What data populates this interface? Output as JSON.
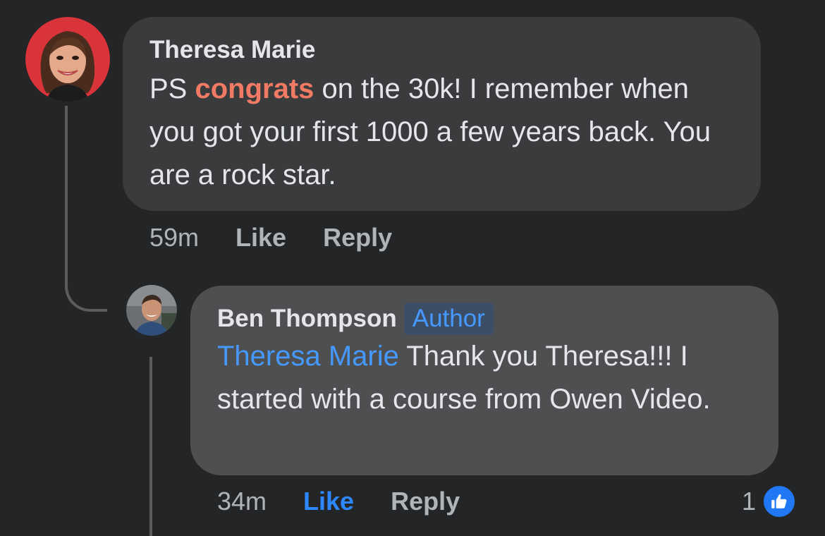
{
  "comments": [
    {
      "author": "Theresa Marie",
      "text_prefix": "PS ",
      "text_highlight": "congrats",
      "text_body": " on the 30k! I remember when you got your first 1000 a few years back. You are a rock star.",
      "time": "59m",
      "like_label": "Like",
      "reply_label": "Reply"
    },
    {
      "author": "Ben Thompson",
      "badge": "Author",
      "mention": "Theresa Marie",
      "text_body": " Thank you Theresa!!! I started with a course from Owen Video.",
      "time": "34m",
      "like_label": "Like",
      "reply_label": "Reply",
      "reaction_count": "1",
      "reaction_icon": "thumbs-up-icon"
    }
  ],
  "colors": {
    "background": "#242526",
    "bubble_primary": "#3a3b3c",
    "bubble_reply": "#4e4f50",
    "link_blue": "#4599ff",
    "highlight_orange": "#f07a63",
    "like_blue": "#2078f4"
  }
}
